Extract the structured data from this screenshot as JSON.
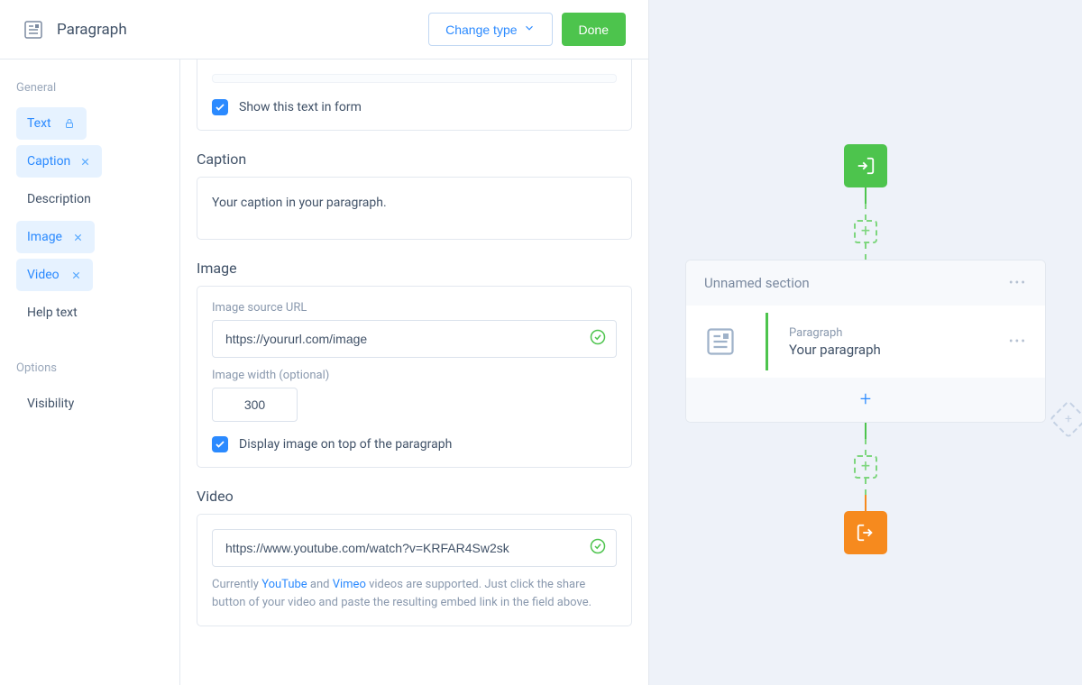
{
  "header": {
    "title": "Paragraph",
    "change_type_label": "Change type",
    "done_label": "Done"
  },
  "sidebar": {
    "group_general": "General",
    "group_options": "Options",
    "items": {
      "text": "Text",
      "caption": "Caption",
      "description": "Description",
      "image": "Image",
      "video": "Video",
      "help_text": "Help text",
      "visibility": "Visibility"
    }
  },
  "text_section": {
    "show_in_form": "Show this text in form"
  },
  "caption_section": {
    "title": "Caption",
    "value": "Your caption in your paragraph."
  },
  "image_section": {
    "title": "Image",
    "source_label": "Image source URL",
    "source_value": "https://yoururl.com/image",
    "width_label": "Image width (optional)",
    "width_value": "300",
    "display_on_top": "Display image on top of the paragraph"
  },
  "video_section": {
    "title": "Video",
    "value": "https://www.youtube.com/watch?v=KRFAR4Sw2sk",
    "help_pre": "Currently ",
    "youtube": "YouTube",
    "help_and": " and ",
    "vimeo": "Vimeo",
    "help_post": " videos are supported. Just click the share button of your video and paste the resulting embed link in the field above."
  },
  "canvas": {
    "section_title": "Unnamed section",
    "para_label": "Paragraph",
    "para_value": "Your paragraph"
  },
  "glyphs": {
    "plus": "+",
    "dots": "•••"
  }
}
